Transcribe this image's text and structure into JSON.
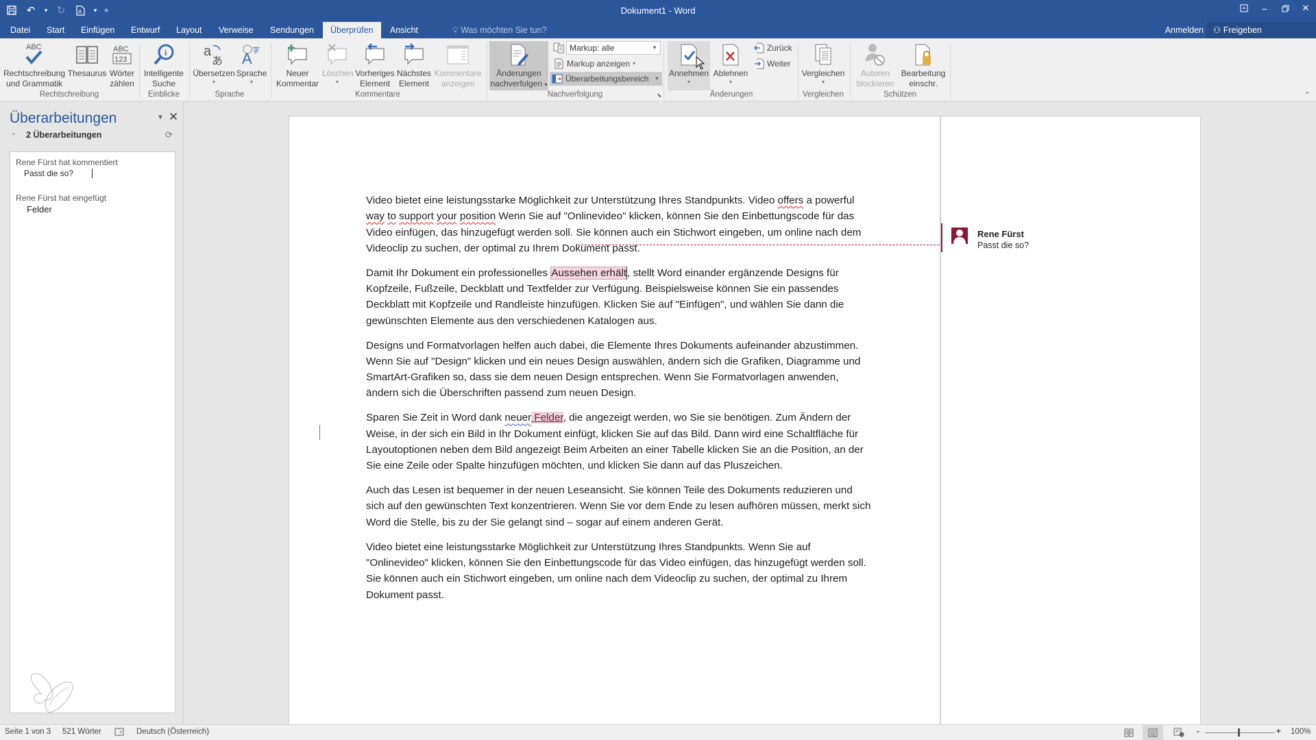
{
  "titlebar": {
    "title": "Dokument1 - Word",
    "qat": {
      "save_icon": "save-icon",
      "undo_icon": "undo-icon",
      "redo_icon": "redo-icon",
      "new_icon": "new-document-icon",
      "customize_icon": "customize-qat-icon"
    },
    "window_controls": [
      "ribbon-display-options",
      "minimize",
      "restore",
      "close"
    ]
  },
  "tabs": {
    "items": [
      {
        "label": "Datei"
      },
      {
        "label": "Start"
      },
      {
        "label": "Einfügen"
      },
      {
        "label": "Entwurf"
      },
      {
        "label": "Layout"
      },
      {
        "label": "Verweise"
      },
      {
        "label": "Sendungen"
      },
      {
        "label": "Überprüfen",
        "active": true
      },
      {
        "label": "Ansicht"
      }
    ],
    "tell_me": "Was möchten Sie tun?",
    "sign_in": "Anmelden",
    "share": "Freigeben"
  },
  "ribbon": {
    "groups": {
      "rechtschreibung": "Rechtschreibung",
      "einblicke": "Einblicke",
      "sprache": "Sprache",
      "kommentare": "Kommentare",
      "nachverfolgung": "Nachverfolgung",
      "aenderungen": "Änderungen",
      "vergleichen": "Vergleichen",
      "schuetzen": "Schützen"
    },
    "buttons": {
      "spelling_1": "Rechtschreibung",
      "spelling_2": "und Grammatik",
      "thesaurus": "Thesaurus",
      "wordcount_1": "Wörter",
      "wordcount_2": "zählen",
      "smart_lookup_1": "Intelligente",
      "smart_lookup_2": "Suche",
      "translate": "Übersetzen",
      "language": "Sprache",
      "new_comment_1": "Neuer",
      "new_comment_2": "Kommentar",
      "delete": "Löschen",
      "previous_1": "Vorheriges",
      "previous_2": "Element",
      "next_1": "Nächstes",
      "next_2": "Element",
      "show_comments_1": "Kommentare",
      "show_comments_2": "anzeigen",
      "track_changes_1": "Änderungen",
      "track_changes_2": "nachverfolgen",
      "markup_select": "Markup: alle",
      "show_markup": "Markup anzeigen",
      "reviewing_pane": "Überarbeitungsbereich",
      "accept": "Annehmen",
      "reject": "Ablehnen",
      "previous_change": "Zurück",
      "next_change": "Weiter",
      "compare": "Vergleichen",
      "block_authors_1": "Autoren",
      "block_authors_2": "blockieren",
      "restrict_editing_1": "Bearbeitung",
      "restrict_editing_2": "einschr."
    },
    "abc": "ABC",
    "num": "123"
  },
  "revisions_pane": {
    "title": "Überarbeitungen",
    "summary": "2 Überarbeitungen",
    "items": [
      {
        "header": "Rene Fürst hat kommentiert",
        "content": "Passt die so?"
      },
      {
        "header": "Rene Fürst hat eingefügt",
        "content": "Felder"
      }
    ]
  },
  "document": {
    "paragraphs": {
      "p1": {
        "a": "Video bietet eine leistungsstarke Möglichkeit zur Unterstützung Ihres Standpunkts. Video ",
        "sq1": "offers",
        "b": " a powerful ",
        "sq2": "way",
        "c": " ",
        "sq3": "to",
        "d": " ",
        "sq4": "support",
        "e": " ",
        "sq5": "your",
        "f": " ",
        "sq6": "position",
        "g": " Wenn Sie auf \"Onlinevideo\" klicken, können Sie den Einbettungscode für das Video einfügen, das hinzugefügt werden soll. Sie können auch ein Stichwort eingeben, um online nach dem Videoclip zu suchen, der optimal zu Ihrem Dokument passt."
      },
      "p2": {
        "a": "Damit Ihr Dokument ein professionelles ",
        "anchor": "Aussehen erhält",
        "b": ", stellt Word einander ergänzende Designs für Kopfzeile, Fußzeile, Deckblatt und Textfelder zur Verfügung. Beispielsweise können Sie ein passendes Deckblatt mit Kopfzeile und Randleiste hinzufügen. Klicken Sie auf \"Einfügen\", und wählen Sie dann die gewünschten Elemente aus den verschiedenen Katalogen aus."
      },
      "p3": "Designs und Formatvorlagen helfen auch dabei, die Elemente Ihres Dokuments aufeinander abzustimmen. Wenn Sie auf \"Design\" klicken und ein neues Design auswählen, ändern sich die Grafiken, Diagramme und SmartArt-Grafiken so, dass sie dem neuen Design entsprechen. Wenn Sie Formatvorlagen anwenden, ändern sich die Überschriften passend zum neuen Design.",
      "p4": {
        "a": "Sparen Sie Zeit in Word dank ",
        "sq": "neuer",
        "space": " ",
        "ins": " Felder",
        "b": ", die angezeigt werden, wo Sie sie benötigen. Zum Ändern der Weise, in der sich ein Bild in Ihr Dokument einfügt, klicken Sie auf das Bild. Dann wird eine Schaltfläche für Layoutoptionen neben dem Bild angezeigt Beim Arbeiten an einer Tabelle klicken Sie an die Position, an der Sie eine Zeile oder Spalte hinzufügen möchten, und klicken Sie dann auf das Pluszeichen."
      },
      "p5": "Auch das Lesen ist bequemer in der neuen Leseansicht. Sie können Teile des Dokuments reduzieren und sich auf den gewünschten Text konzentrieren. Wenn Sie vor dem Ende zu lesen aufhören müssen, merkt sich Word die Stelle, bis zu der Sie gelangt sind – sogar auf einem anderen Gerät.",
      "p6": "Video bietet eine leistungsstarke Möglichkeit zur Unterstützung Ihres Standpunkts. Wenn Sie auf \"Onlinevideo\" klicken, können Sie den Einbettungscode für das Video einfügen, das hinzugefügt werden soll. Sie können auch ein Stichwort eingeben, um online nach dem Videoclip zu suchen, der optimal zu Ihrem Dokument passt."
    },
    "comment": {
      "author": "Rene Fürst",
      "text": "Passt die so?",
      "color": "#8b1738"
    }
  },
  "statusbar": {
    "page": "Seite 1 von 3",
    "words": "521 Wörter",
    "language": "Deutsch (Österreich)",
    "zoom": "100%",
    "zoom_minus": "-",
    "zoom_plus": "+",
    "zoom_percent": 100
  },
  "colors": {
    "accent": "#2b579a",
    "comment": "#8b1738"
  }
}
